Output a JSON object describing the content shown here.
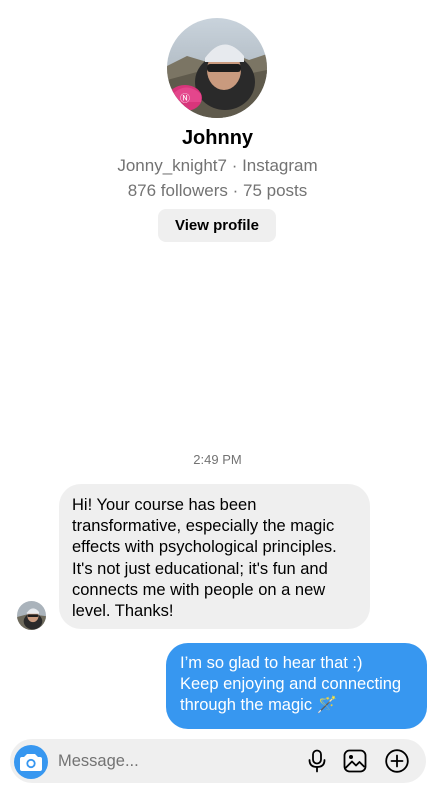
{
  "profile": {
    "name": "Johnny",
    "username_line": "Jonny_knight7 · Instagram",
    "stats_line": "876 followers · 75 posts",
    "view_profile_label": "View profile"
  },
  "thread": {
    "timestamp": "2:49 PM",
    "messages": [
      {
        "direction": "incoming",
        "lines": [
          "Hi! Your course has been",
          "transformative, especially the magic",
          "effects with psychological principles.",
          "It's not just educational; it's fun and",
          "connects me with people on a new",
          "level. Thanks!"
        ]
      },
      {
        "direction": "outgoing",
        "lines": [
          "I’m so glad to hear that :)",
          "Keep enjoying and connecting",
          "through the magic 🪄"
        ]
      }
    ]
  },
  "composer": {
    "placeholder": "Message...",
    "icons": [
      "camera-icon",
      "microphone-icon",
      "image-icon",
      "plus-circle-icon"
    ]
  },
  "colors": {
    "accent": "#3797f0",
    "incoming_bubble": "#efefef",
    "secondary_text": "#737373"
  }
}
